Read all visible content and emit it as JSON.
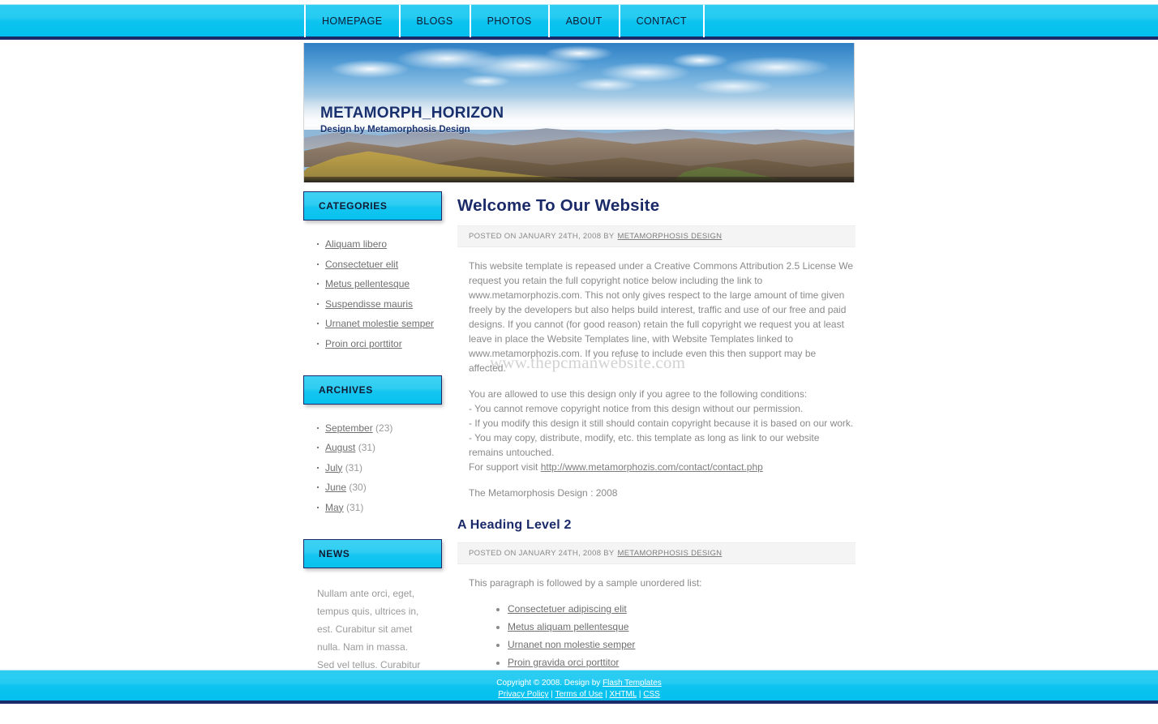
{
  "nav": {
    "items": [
      {
        "label": "HOMEPAGE"
      },
      {
        "label": "BLOGS"
      },
      {
        "label": "PHOTOS"
      },
      {
        "label": "ABOUT"
      },
      {
        "label": "CONTACT"
      }
    ]
  },
  "banner": {
    "title": "METAMORPH_HORIZON",
    "subtitle": "Design by Metamorphosis Design",
    "image_name": "mountain-landscape-panorama"
  },
  "sidebar": {
    "categories": {
      "heading": "CATEGORIES",
      "items": [
        {
          "label": "Aliquam libero"
        },
        {
          "label": "Consectetuer elit"
        },
        {
          "label": "Metus pellentesque"
        },
        {
          "label": "Suspendisse mauris"
        },
        {
          "label": "Urnanet molestie semper"
        },
        {
          "label": "Proin orci porttitor"
        }
      ]
    },
    "archives": {
      "heading": "ARCHIVES",
      "items": [
        {
          "label": "September",
          "count": "(23)"
        },
        {
          "label": "August",
          "count": "(31)"
        },
        {
          "label": "July",
          "count": "(31)"
        },
        {
          "label": "June",
          "count": "(30)"
        },
        {
          "label": "May",
          "count": "(31)"
        }
      ]
    },
    "news": {
      "heading": "NEWS",
      "text": "Nullam ante orci, eget, tempus quis, ultrices in, est. Curabitur sit amet nulla. Nam in massa. Sed vel tellus. Curabitur sem urna, consequat vel"
    }
  },
  "main": {
    "post1": {
      "title": "Welcome To Our Website",
      "meta_prefix": "POSTED ON JANUARY 24TH, 2008 BY",
      "meta_author": "METAMORPHOSIS DESIGN",
      "para1": "This website template is repeased under a Creative Commons Attribution 2.5 License We request you retain the full copyright notice below including the link to www.metamorphozis.com. This not only gives respect to the large amount of time given freely by the developers but also helps build interest, traffic and use of our free and paid designs. If you cannot (for good reason) retain the full copyright we request you at least leave in place the Website Templates line, with Website Templates linked to www.metamorphozis.com. If you refuse to include even this then support may be affected.",
      "para2_intro": "You are allowed to use this design only if you agree to the following conditions:",
      "cond1": "- You cannot remove copyright notice from this design without our permission.",
      "cond2": "- If you modify this design it still should contain copyright because it is based on our work.",
      "cond3": "- You may copy, distribute, modify, etc. this template as long as link to our website remains untouched.",
      "support_prefix": "For support visit",
      "support_link": "http://www.metamorphozis.com/contact/contact.php",
      "signature": "The Metamorphosis Design : 2008"
    },
    "post2": {
      "title": "A Heading Level 2",
      "meta_prefix": "POSTED ON JANUARY 24TH, 2008 BY",
      "meta_author": "METAMORPHOSIS DESIGN",
      "intro": "This paragraph is followed by a sample unordered list:",
      "list": [
        {
          "label": "Consectetuer adipiscing elit"
        },
        {
          "label": "Metus aliquam pellentesque"
        },
        {
          "label": "Urnanet non molestie semper"
        },
        {
          "label": "Proin gravida orci porttitor"
        }
      ]
    }
  },
  "watermark": {
    "text": "www.thepcmanwebsite.com"
  },
  "footer": {
    "copyright_prefix": "Copyright © 2008. Design by",
    "copyright_link": "Flash Templates",
    "links": [
      {
        "label": "Privacy Policy"
      },
      {
        "label": "Terms of Use"
      },
      {
        "label": "XHTML"
      },
      {
        "label": "CSS"
      }
    ],
    "separator": "|"
  },
  "colors": {
    "accent_cyan": "#0dc3ef",
    "navy": "#1b2a68",
    "body_text": "#8a8a8a"
  }
}
